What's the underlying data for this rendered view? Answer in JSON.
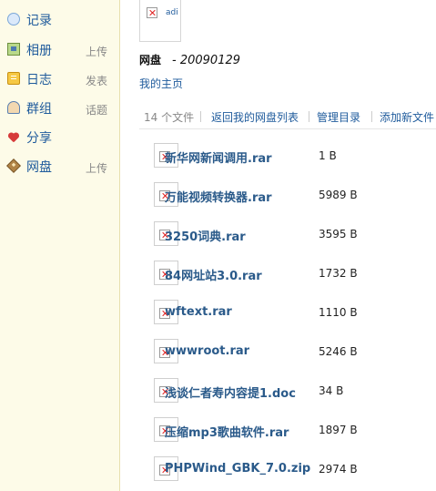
{
  "sidebar": {
    "items": [
      {
        "label": "记录",
        "sub": "",
        "icon": "chat-bubble-icon"
      },
      {
        "label": "相册",
        "sub": "上传",
        "icon": "photo-icon"
      },
      {
        "label": "日志",
        "sub": "发表",
        "icon": "diary-icon"
      },
      {
        "label": "群组",
        "sub": "话题",
        "icon": "group-icon"
      },
      {
        "label": "分享",
        "sub": "",
        "icon": "heart-share-icon"
      },
      {
        "label": "网盘",
        "sub": "上传",
        "icon": "netdisk-icon"
      }
    ]
  },
  "header": {
    "avatar_alt": "adi",
    "title_bold": "网盘",
    "title_date": "- 20090129",
    "home_link": "我的主页"
  },
  "toolbar": {
    "file_count": "14 个文件",
    "back_link": "返回我的网盘列表",
    "manage_link": "管理目录",
    "add_link": "添加新文件"
  },
  "files": [
    {
      "name": "新华网新闻调用.rar",
      "size": "1 B"
    },
    {
      "name": "万能视频转换器.rar",
      "size": "5989 B"
    },
    {
      "name": "3250词典.rar",
      "size": "3595 B"
    },
    {
      "name": "84网址站3.0.rar",
      "size": "1732 B"
    },
    {
      "name": "wftext.rar",
      "size": "1110 B"
    },
    {
      "name": "wwwroot.rar",
      "size": "5246 B"
    },
    {
      "name": "浅谈仁者寿内容提1.doc",
      "size": "34 B"
    },
    {
      "name": "压缩mp3歌曲软件.rar",
      "size": "1897 B"
    },
    {
      "name": "PHPWind_GBK_7.0.zip",
      "size": "2974 B"
    }
  ]
}
